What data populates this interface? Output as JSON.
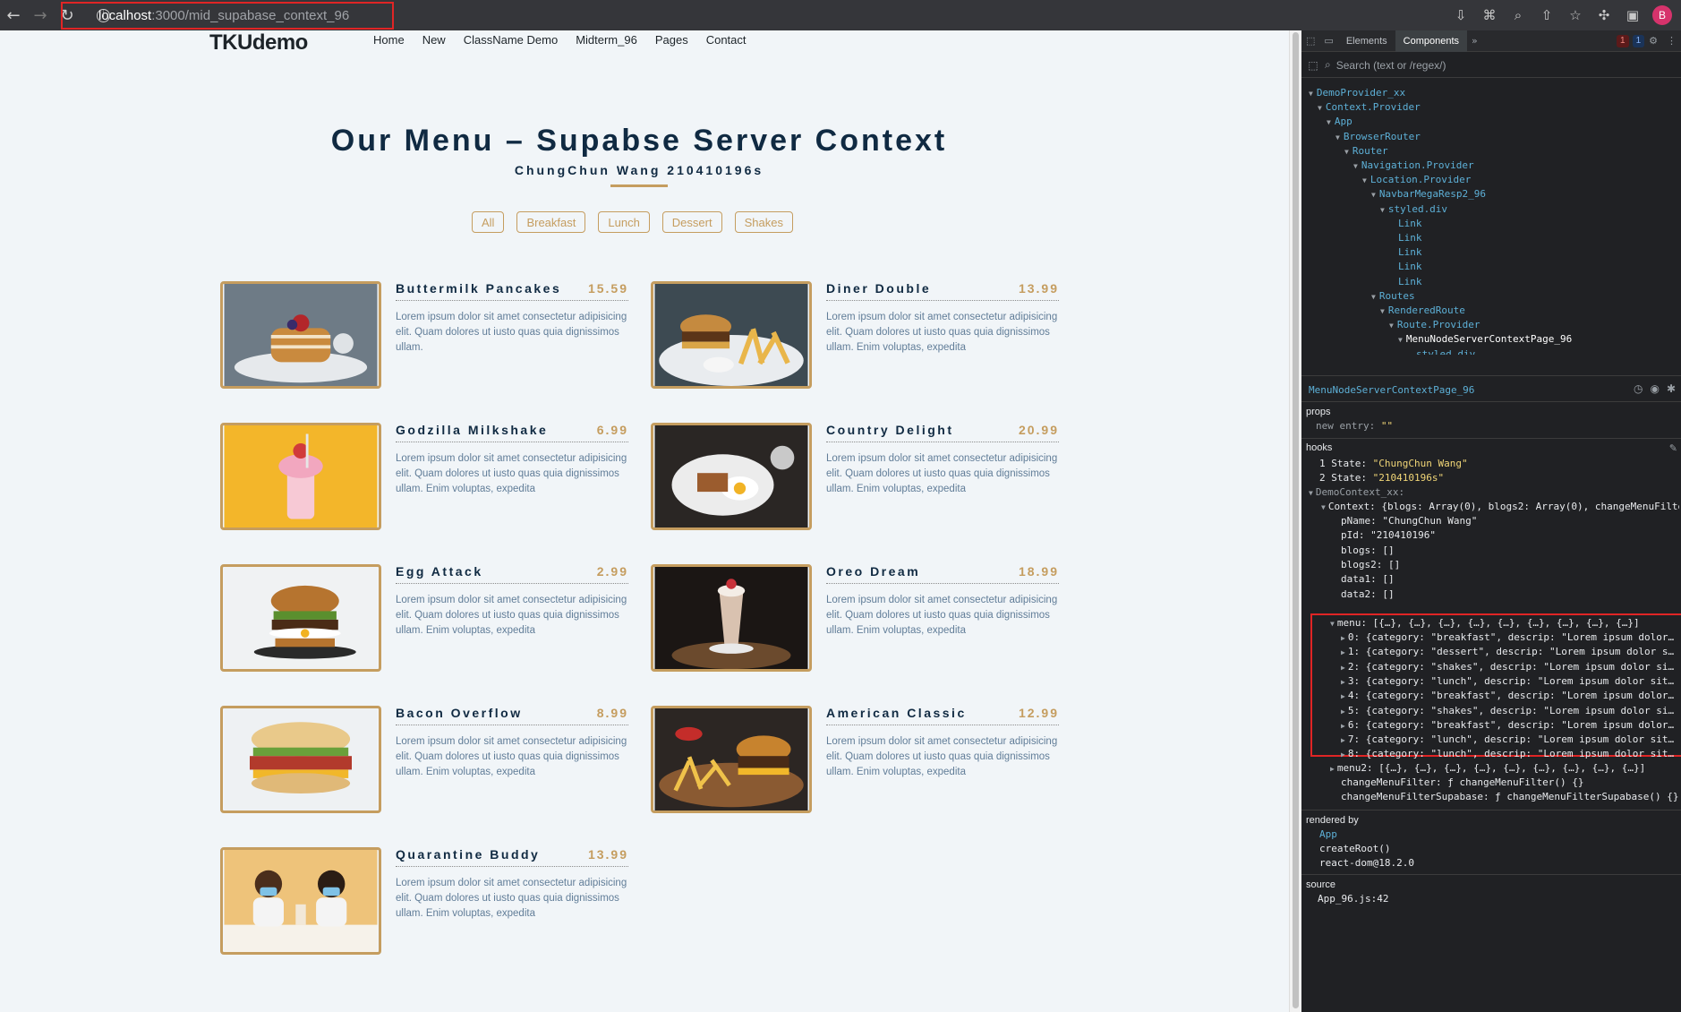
{
  "browser": {
    "url_host": "localhost",
    "url_path": ":3000/mid_supabase_context_96",
    "profile_initial": "B"
  },
  "site": {
    "logo": "TKUdemo",
    "nav": [
      "Home",
      "New",
      "ClassName Demo",
      "Midterm_96",
      "Pages",
      "Contact"
    ],
    "title": "Our Menu – Supabse Server Context",
    "subtitle": "ChungChun Wang 210410196s",
    "filters": [
      "All",
      "Breakfast",
      "Lunch",
      "Dessert",
      "Shakes"
    ],
    "items": [
      {
        "name": "Buttermilk Pancakes",
        "price": "15.59",
        "desc": "Lorem ipsum dolor sit amet consectetur adipisicing elit. Quam dolores ut iusto quas quia dignissimos ullam."
      },
      {
        "name": "Diner Double",
        "price": "13.99",
        "desc": "Lorem ipsum dolor sit amet consectetur adipisicing elit. Quam dolores ut iusto quas quia dignissimos ullam. Enim voluptas, expedita"
      },
      {
        "name": "Godzilla Milkshake",
        "price": "6.99",
        "desc": "Lorem ipsum dolor sit amet consectetur adipisicing elit. Quam dolores ut iusto quas quia dignissimos ullam. Enim voluptas, expedita"
      },
      {
        "name": "Country Delight",
        "price": "20.99",
        "desc": "Lorem ipsum dolor sit amet consectetur adipisicing elit. Quam dolores ut iusto quas quia dignissimos ullam. Enim voluptas, expedita"
      },
      {
        "name": "Egg Attack",
        "price": "2.99",
        "desc": "Lorem ipsum dolor sit amet consectetur adipisicing elit. Quam dolores ut iusto quas quia dignissimos ullam. Enim voluptas, expedita"
      },
      {
        "name": "Oreo Dream",
        "price": "18.99",
        "desc": "Lorem ipsum dolor sit amet consectetur adipisicing elit. Quam dolores ut iusto quas quia dignissimos ullam. Enim voluptas, expedita"
      },
      {
        "name": "Bacon Overflow",
        "price": "8.99",
        "desc": "Lorem ipsum dolor sit amet consectetur adipisicing elit. Quam dolores ut iusto quas quia dignissimos ullam. Enim voluptas, expedita"
      },
      {
        "name": "American Classic",
        "price": "12.99",
        "desc": "Lorem ipsum dolor sit amet consectetur adipisicing elit. Quam dolores ut iusto quas quia dignissimos ullam. Enim voluptas, expedita"
      },
      {
        "name": "Quarantine Buddy",
        "price": "13.99",
        "desc": "Lorem ipsum dolor sit amet consectetur adipisicing elit. Quam dolores ut iusto quas quia dignissimos ullam. Enim voluptas, expedita"
      }
    ]
  },
  "devtools": {
    "tabs": [
      "Elements",
      "Components"
    ],
    "error_count": "1",
    "message_count": "1",
    "search_placeholder": "Search (text or /regex/)",
    "tree": [
      "DemoProvider_xx",
      "Context.Provider",
      "App",
      "BrowserRouter",
      "Router",
      "Navigation.Provider",
      "Location.Provider",
      "NavbarMegaResp2_96",
      "styled.div",
      "Link",
      "Link",
      "Link",
      "Link",
      "Link",
      "Routes",
      "RenderedRoute",
      "Route.Provider",
      "MenuNodeServerContextPage_96",
      "styled.div"
    ],
    "selected_component": "MenuNodeServerContextPage_96",
    "props_label": "props",
    "props_new_entry": "new entry:",
    "props_new_value": "\"\"",
    "hooks_label": "hooks",
    "state1_key": "1 State:",
    "state1": "\"ChungChun Wang\"",
    "state2_key": "2 State:",
    "state2": "\"210410196s\"",
    "context_name": "DemoContext_xx:",
    "context_summary": "Context: {blogs: Array(0), blogs2: Array(0), changeMenuFilte",
    "fields": [
      "pName: \"ChungChun Wang\"",
      "pId: \"210410196\"",
      "blogs: []",
      "blogs2: []",
      "data1: []",
      "data2: []"
    ],
    "menu_line": "menu: [{…}, {…}, {…}, {…}, {…}, {…}, {…}, {…}, {…}]",
    "menu_entries": [
      "0: {category: \"breakfast\", descrip: \"Lorem ipsum dolor…",
      "1: {category: \"dessert\", descrip: \"Lorem ipsum dolor s…",
      "2: {category: \"shakes\", descrip: \"Lorem ipsum dolor si…",
      "3: {category: \"lunch\", descrip: \"Lorem ipsum dolor sit…",
      "4: {category: \"breakfast\", descrip: \"Lorem ipsum dolor…",
      "5: {category: \"shakes\", descrip: \"Lorem ipsum dolor si…",
      "6: {category: \"breakfast\", descrip: \"Lorem ipsum dolor…",
      "7: {category: \"lunch\", descrip: \"Lorem ipsum dolor sit…",
      "8: {category: \"lunch\", descrip: \"Lorem ipsum dolor sit…"
    ],
    "menu2_line": "menu2: [{…}, {…}, {…}, {…}, {…}, {…}, {…}, {…}, {…}]",
    "change1": "changeMenuFilter: ƒ changeMenuFilter() {}",
    "change2": "changeMenuFilterSupabase: ƒ changeMenuFilterSupabase() {}",
    "rendered_by_label": "rendered by",
    "rendered_by": [
      "App",
      "createRoot()",
      "react-dom@18.2.0"
    ],
    "source_label": "source",
    "source": "App_96.js:42"
  }
}
